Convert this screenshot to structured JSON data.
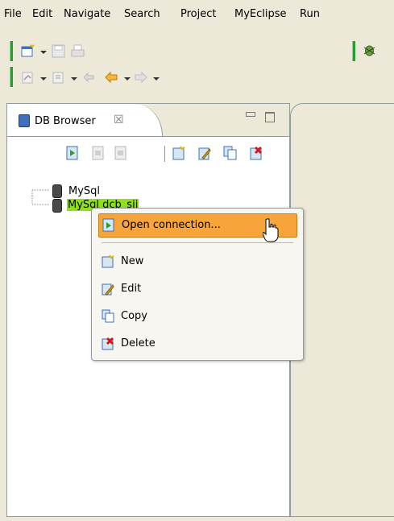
{
  "menubar": {
    "items": [
      "File",
      "Edit",
      "Navigate",
      "Search",
      "Project",
      "MyEclipse",
      "Run"
    ]
  },
  "view": {
    "tab_label": "DB Browser",
    "tab_close_glyph": "☒",
    "toolbar_icons": [
      "open-connection-icon",
      "disconnect-icon",
      "disconnect-all-icon",
      "new-connection-icon",
      "edit-connection-icon",
      "copy-connection-icon",
      "delete-connection-icon"
    ]
  },
  "tree": {
    "nodes": [
      {
        "label": "MySql",
        "selected": false
      },
      {
        "label": "MySql dcb_sij",
        "selected": true
      }
    ]
  },
  "context_menu": {
    "items": [
      {
        "label": "Open connection...",
        "highlighted": true,
        "icon": "open-connection-icon"
      },
      {
        "label": "New",
        "highlighted": false,
        "icon": "new-connection-icon"
      },
      {
        "label": "Edit",
        "highlighted": false,
        "icon": "edit-connection-icon"
      },
      {
        "label": "Copy",
        "highlighted": false,
        "icon": "copy-connection-icon"
      },
      {
        "label": "Delete",
        "highlighted": false,
        "icon": "delete-connection-icon"
      }
    ]
  },
  "colors": {
    "selection_green": "#8fe01a",
    "menu_highlight": "#f7a43b",
    "grip_green": "#2a9b37"
  }
}
